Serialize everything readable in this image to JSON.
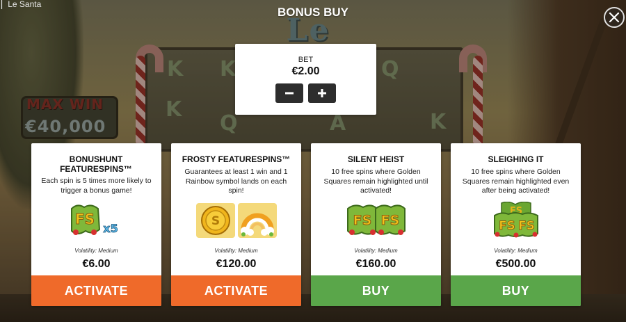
{
  "tab": {
    "label": "Le Santa"
  },
  "background": {
    "logo": "Le Santa",
    "logo_tm": "TM",
    "max_win_title": "MAX WIN",
    "max_win_amount": "€40,000",
    "reel_symbols": [
      "K",
      "K",
      "Q",
      "K",
      "Q",
      "A",
      "K"
    ]
  },
  "modal": {
    "title": "BONUS BUY",
    "close_icon": "close-icon"
  },
  "bet": {
    "label": "BET",
    "value": "€2.00",
    "decrease_icon": "minus-icon",
    "increase_icon": "plus-icon"
  },
  "cards": [
    {
      "title": "BONUSHUNT FEATURESPINS™",
      "description": "Each spin is 5 times more likely to trigger a bonus game!",
      "art_icon": "fs-x5-icon",
      "art_text": "FS",
      "art_multiplier": "x5",
      "volatility": "Volatility: Medium",
      "price": "€6.00",
      "action": "ACTIVATE",
      "action_color": "#ef6a2a"
    },
    {
      "title": "FROSTY FEATURESPINS™",
      "description": "Guarantees at least 1 win and 1 Rainbow symbol lands on each spin!",
      "art_icon": "coin-and-rainbow-icon",
      "volatility": "Volatility: Medium",
      "price": "€120.00",
      "action": "ACTIVATE",
      "action_color": "#ef6a2a"
    },
    {
      "title": "SILENT HEIST",
      "description": "10 free spins where Golden Squares remain highlighted until activated!",
      "art_icon": "fs-fs-icon",
      "art_text": "FS",
      "volatility": "Volatility: Medium",
      "price": "€160.00",
      "action": "BUY",
      "action_color": "#5aa64a"
    },
    {
      "title": "SLEIGHING IT",
      "description": "10 free spins where Golden Squares remain highlighted even after being activated!",
      "art_icon": "fs-stack-icon",
      "art_text": "FS",
      "volatility": "Volatility: Medium",
      "price": "€500.00",
      "action": "BUY",
      "action_color": "#5aa64a"
    }
  ]
}
